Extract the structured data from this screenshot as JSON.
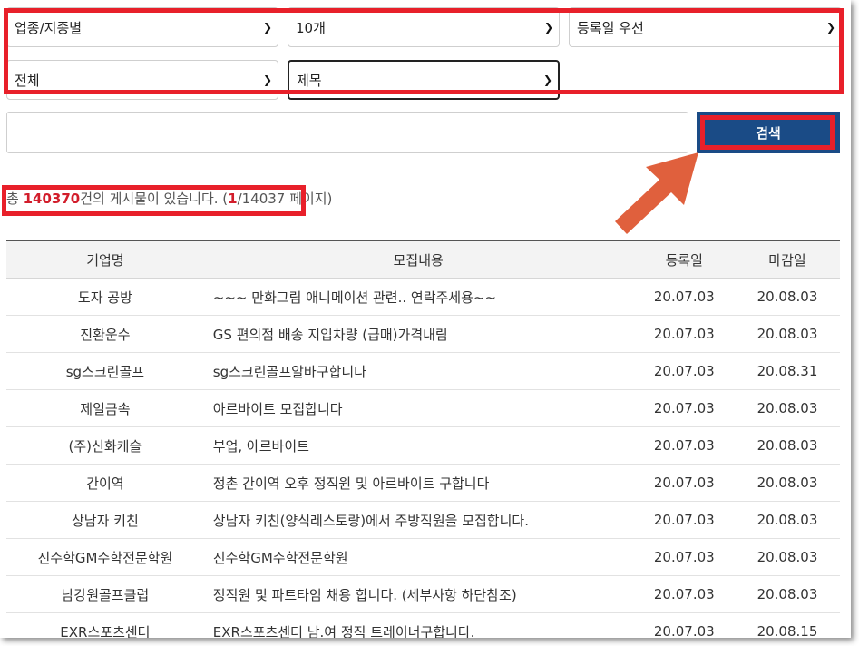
{
  "filters": {
    "industry": "업종/지종별",
    "per_page": "10개",
    "sort": "등록일 우선",
    "region": "전체",
    "field": "제목"
  },
  "search": {
    "placeholder": "",
    "button_label": "검색"
  },
  "result_count": {
    "prefix": "총 ",
    "total": "140370",
    "middle": "건의 게시물이 있습니다. (",
    "current_page": "1",
    "suffix": "/14037 페이지)"
  },
  "table": {
    "headers": [
      "기업명",
      "모집내용",
      "등록일",
      "마감일"
    ],
    "rows": [
      {
        "company": "도자 공방",
        "content": "~~~ 만화그림 애니메이션 관련.. 연락주세용~~",
        "registered": "20.07.03",
        "deadline": "20.08.03"
      },
      {
        "company": "진환운수",
        "content": "GS 편의점 배송 지입차량 (급매)가격내림",
        "registered": "20.07.03",
        "deadline": "20.08.03"
      },
      {
        "company": "sg스크린골프",
        "content": "sg스크린골프알바구합니다",
        "registered": "20.07.03",
        "deadline": "20.08.31"
      },
      {
        "company": "제일금속",
        "content": "아르바이트 모집합니다",
        "registered": "20.07.03",
        "deadline": "20.08.03"
      },
      {
        "company": "(주)신화케슬",
        "content": "부업, 아르바이트",
        "registered": "20.07.03",
        "deadline": "20.08.03"
      },
      {
        "company": "간이역",
        "content": "정촌 간이역 오후 정직원 및 아르바이트 구합니다",
        "registered": "20.07.03",
        "deadline": "20.08.03"
      },
      {
        "company": "상남자 키친",
        "content": "상남자 키친(양식레스토랑)에서 주방직원을 모집합니다.",
        "registered": "20.07.03",
        "deadline": "20.08.03"
      },
      {
        "company": "진수학GM수학전문학원",
        "content": "진수학GM수학전문학원",
        "registered": "20.07.03",
        "deadline": "20.08.03"
      },
      {
        "company": "남강원골프클럽",
        "content": "정직원 및 파트타임 채용 합니다. (세부사항 하단참조)",
        "registered": "20.07.03",
        "deadline": "20.08.03"
      },
      {
        "company": "EXR스포츠센터",
        "content": "EXR스포츠센터 남.여 정직 트레이너구합니다.",
        "registered": "20.07.03",
        "deadline": "20.08.15"
      }
    ]
  },
  "colors": {
    "highlight_red": "#e8202a",
    "button_blue": "#1a4b86",
    "arrow_orange": "#e0603d"
  },
  "icons": {
    "dropdown": "chevron-down-icon",
    "pointer": "arrow-up-right-icon"
  }
}
